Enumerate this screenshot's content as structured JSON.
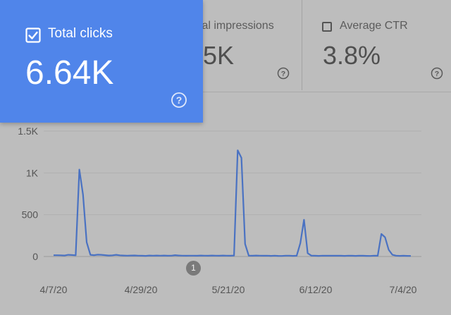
{
  "metrics": {
    "total_clicks": {
      "label": "Total clicks",
      "value": "6.64K",
      "selected": true
    },
    "total_impressions": {
      "label": "tal impressions",
      "value": "5K",
      "selected": false
    },
    "average_ctr": {
      "label": "Average CTR",
      "value": "3.8%",
      "selected": false
    }
  },
  "help_glyph": "?",
  "annotation": {
    "label": "1"
  },
  "colors": {
    "accent": "#5085ea",
    "line": "#4a72c2",
    "background": "#bdbdbd"
  },
  "chart_data": {
    "type": "line",
    "x_tick_labels": [
      "4/7/20",
      "4/29/20",
      "5/21/20",
      "6/12/20",
      "7/4/20"
    ],
    "y_tick_labels": [
      "0",
      "500",
      "1K",
      "1.5K"
    ],
    "ylim": [
      0,
      1500
    ],
    "grid": true,
    "series": [
      {
        "values": [
          15,
          15,
          14,
          12,
          20,
          18,
          14,
          1040,
          740,
          170,
          20,
          16,
          22,
          20,
          16,
          12,
          14,
          20,
          14,
          12,
          10,
          12,
          13,
          10,
          9,
          8,
          12,
          10,
          12,
          10,
          12,
          9,
          10,
          16,
          12,
          10,
          9,
          10,
          10,
          9,
          12,
          10,
          9,
          12,
          10,
          9,
          12,
          10,
          9,
          12,
          1270,
          1180,
          150,
          10,
          9,
          12,
          10,
          9,
          10,
          8,
          10,
          8,
          7,
          10,
          10,
          8,
          9,
          160,
          440,
          40,
          10,
          9,
          8,
          10,
          9,
          10,
          9,
          10,
          9,
          8,
          10,
          9,
          8,
          10,
          9,
          8,
          7,
          10,
          9,
          270,
          230,
          80,
          20,
          10,
          8,
          9,
          8,
          7
        ]
      }
    ]
  }
}
